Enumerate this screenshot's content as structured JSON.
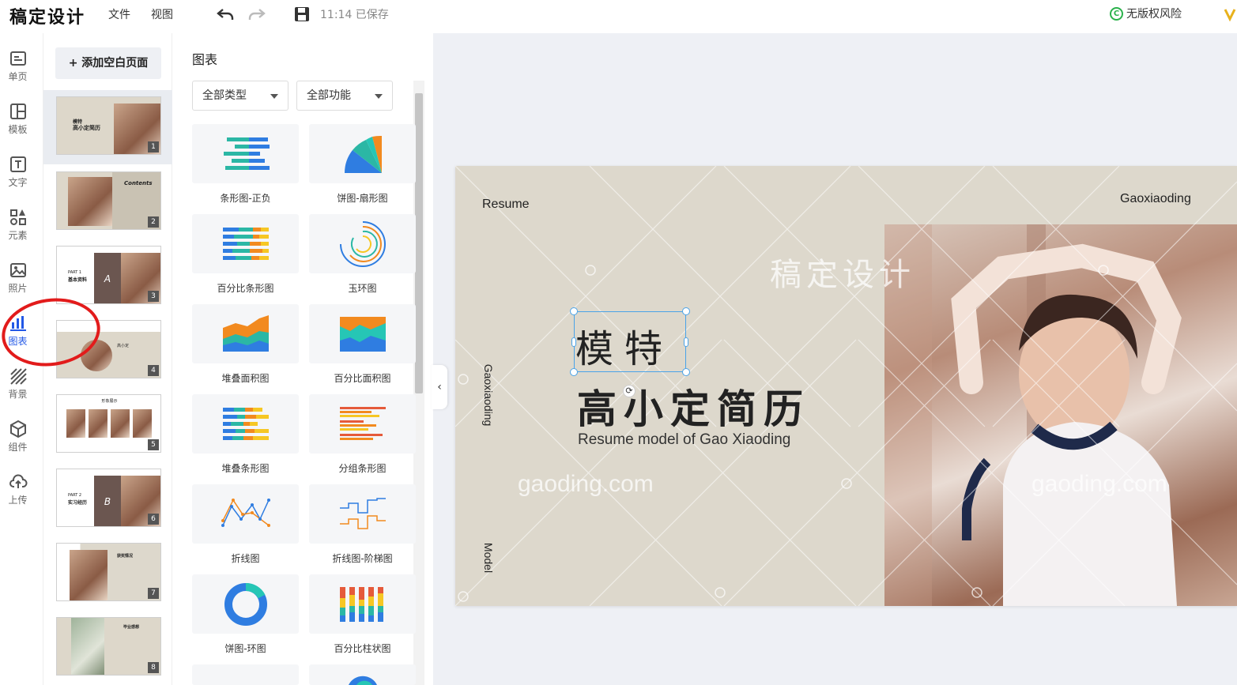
{
  "topbar": {
    "brand": "稿定设计",
    "menu_file": "文件",
    "menu_view": "视图",
    "saved_status": "11:14 已保存",
    "risk_label": "无版权风险"
  },
  "leftnav": {
    "items": [
      {
        "label": "单页",
        "icon": "single-page-icon"
      },
      {
        "label": "模板",
        "icon": "template-icon"
      },
      {
        "label": "文字",
        "icon": "text-icon"
      },
      {
        "label": "元素",
        "icon": "elements-icon"
      },
      {
        "label": "照片",
        "icon": "photo-icon"
      },
      {
        "label": "图表",
        "icon": "chart-icon",
        "active": true
      },
      {
        "label": "背景",
        "icon": "background-icon"
      },
      {
        "label": "组件",
        "icon": "component-icon"
      },
      {
        "label": "上传",
        "icon": "upload-icon"
      }
    ]
  },
  "pages": {
    "add_label": "+ 添加空白页面",
    "thumb_texts": {
      "p1_title": "模特",
      "p1_sub": "高小定简历",
      "p2_title": "Contents",
      "p3_part": "PART 1",
      "p3_sub": "基本资料",
      "p3_letter": "A",
      "p4_name": "高小定",
      "p5_title": "形象展示",
      "p6_part": "PART 2",
      "p6_sub": "实习经历",
      "p6_letter": "B",
      "p7_title": "获奖情况",
      "p8_title": "毕业感想"
    },
    "numbers": [
      "1",
      "2",
      "3",
      "4",
      "5",
      "6",
      "7",
      "8"
    ]
  },
  "panel": {
    "title": "图表",
    "filter_type": "全部类型",
    "filter_function": "全部功能",
    "charts": [
      {
        "label": "条形图-正负"
      },
      {
        "label": "饼图-扇形图"
      },
      {
        "label": "百分比条形图"
      },
      {
        "label": "玉环图"
      },
      {
        "label": "堆叠面积图"
      },
      {
        "label": "百分比面积图"
      },
      {
        "label": "堆叠条形图"
      },
      {
        "label": "分组条形图"
      },
      {
        "label": "折线图"
      },
      {
        "label": "折线图-阶梯图"
      },
      {
        "label": "饼图-环图"
      },
      {
        "label": "百分比柱状图"
      }
    ]
  },
  "slide": {
    "resume": "Resume",
    "gaoxiaoding_top": "Gaoxiaoding",
    "gaoxiaoding_side": "Gaoxiaoding",
    "model_side": "Model",
    "title_selected": "模特",
    "title_main": "高小定简历",
    "subtitle": "Resume model of Gao Xiaoding",
    "watermark_brand": "稿定设计",
    "watermark_domain_1": "gaoding.com",
    "watermark_domain_2": "gaoding.com"
  },
  "colors": {
    "accent_blue": "#2258e6",
    "annotation_red": "#e21b1b",
    "slide_bg": "#ddd8cc",
    "selection": "#4aa3e8"
  }
}
